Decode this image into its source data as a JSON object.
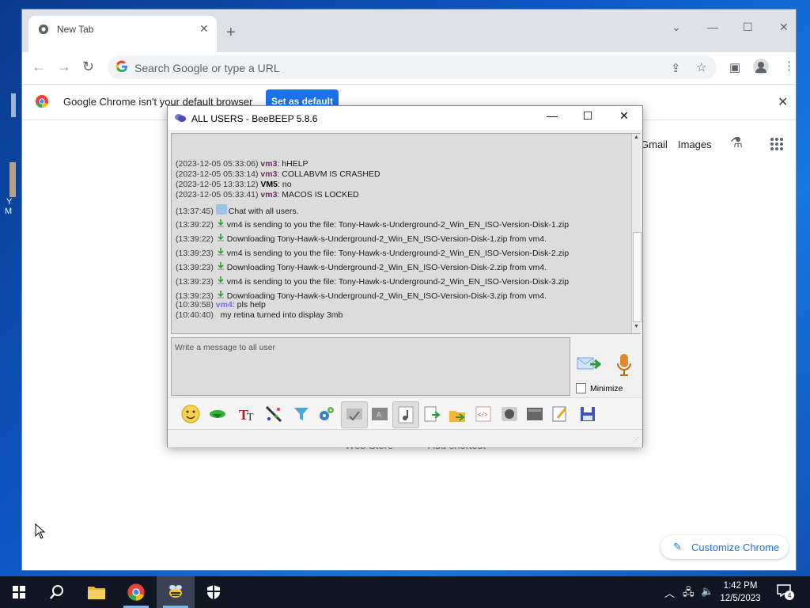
{
  "desktop": {
    "icon_text_1": "Y",
    "icon_text_2": "M"
  },
  "chrome": {
    "tab_title": "New Tab",
    "omnibox_placeholder": "Search Google or type a URL",
    "infobar_message": "Google Chrome isn't your default browser",
    "infobar_button": "Set as default",
    "ntp_links": {
      "gmail": "Gmail",
      "images": "Images"
    },
    "shortcuts_hidden": {
      "web_store": "Web Store",
      "add_shortcut": "Add shortcut"
    },
    "customize_label": "Customize Chrome"
  },
  "beebeep": {
    "title": "ALL USERS - BeeBEEP 5.8.6",
    "messages": [
      {
        "ts": "(2023-12-05 05:33:06)",
        "user": "vm3",
        "text": ": hHELP"
      },
      {
        "ts": "(2023-12-05 05:33:14)",
        "user": "vm3",
        "text": ": COLLABVM IS CRASHED"
      },
      {
        "ts": "(2023-12-05 13:33:12)",
        "user": "VM5",
        "text": ": no"
      },
      {
        "ts": "(2023-12-05 05:33:41)",
        "user": "vm3",
        "text": ": MACOS IS LOCKED"
      },
      {
        "ts": "(13:37:45)",
        "text": "Chat with all users."
      },
      {
        "ts": "(13:39:22)",
        "text": "vm4 is sending to you the file: Tony-Hawk-s-Underground-2_Win_EN_ISO-Version-Disk-1.zip"
      },
      {
        "ts": "(13:39:22)",
        "text": "Downloading Tony-Hawk-s-Underground-2_Win_EN_ISO-Version-Disk-1.zip from vm4."
      },
      {
        "ts": "(13:39:23)",
        "text": "vm4 is sending to you the file: Tony-Hawk-s-Underground-2_Win_EN_ISO-Version-Disk-2.zip"
      },
      {
        "ts": "(13:39:23)",
        "text": "Downloading Tony-Hawk-s-Underground-2_Win_EN_ISO-Version-Disk-2.zip from vm4."
      },
      {
        "ts": "(13:39:23)",
        "text": "vm4 is sending to you the file: Tony-Hawk-s-Underground-2_Win_EN_ISO-Version-Disk-3.zip"
      },
      {
        "ts": "(13:39:23)",
        "text": "Downloading Tony-Hawk-s-Underground-2_Win_EN_ISO-Version-Disk-3.zip from vm4."
      },
      {
        "ts": "(10:39:58)",
        "user": "vm4",
        "text": ": pls help"
      },
      {
        "ts": "(10:40:40)",
        "text": "my retina turned into display 3mb"
      }
    ],
    "input_placeholder": "Write a message to all user",
    "minimize_label": "Minimize"
  },
  "taskbar": {
    "time": "1:42 PM",
    "date": "12/5/2023",
    "notification_count": "4"
  }
}
